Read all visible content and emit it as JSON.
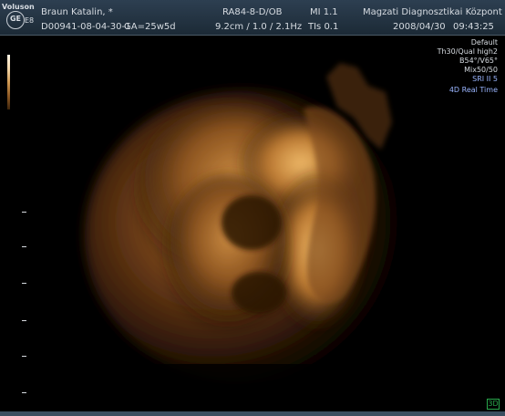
{
  "header": {
    "brand": "Voluson",
    "logo_ge": "GE",
    "logo_e8": "E8",
    "patient_name": "Braun Katalin, *",
    "patient_id": "D00941-08-04-30-1",
    "gestational_age": "GA=25w5d",
    "probe": "RA84-8-D/OB",
    "depth_freq": "9.2cm / 1.0 / 2.1Hz",
    "mi": "MI 1.1",
    "tis": "TIs 0.1",
    "institution": "Magzati Diagnosztikai Központ",
    "date": "2008/04/30",
    "time": "09:43:25"
  },
  "right_status": {
    "line1": "Default",
    "line2": "Th30/Qual high2",
    "line3": "B54°/V65°",
    "line4": "Mix50/50",
    "line5": "SRI II 5",
    "line6": "4D Real Time"
  },
  "badge": "3D",
  "scale": {
    "ticks": 8
  }
}
